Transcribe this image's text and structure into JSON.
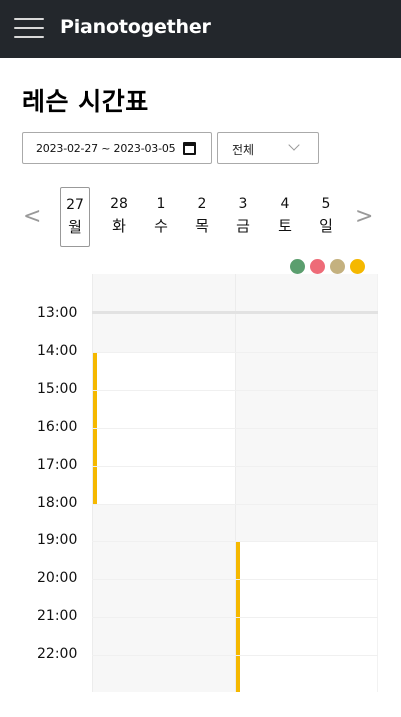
{
  "app": {
    "title": "Pianotogether"
  },
  "page": {
    "title": "레슨 시간표"
  },
  "date_range": {
    "value": "2023-02-27 ~ 2023-03-05"
  },
  "filter": {
    "selected": "전체"
  },
  "nav": {
    "prev_symbol": "<",
    "next_symbol": ">"
  },
  "days": [
    {
      "day": "27",
      "weekday": "월",
      "selected": true
    },
    {
      "day": "28",
      "weekday": "화",
      "selected": false
    },
    {
      "day": "1",
      "weekday": "수",
      "selected": false
    },
    {
      "day": "2",
      "weekday": "목",
      "selected": false
    },
    {
      "day": "3",
      "weekday": "금",
      "selected": false
    },
    {
      "day": "4",
      "weekday": "토",
      "selected": false
    },
    {
      "day": "5",
      "weekday": "일",
      "selected": false
    }
  ],
  "legend_colors": [
    "#5b9e6e",
    "#ee6b78",
    "#c4b17f",
    "#f5b800"
  ],
  "times": [
    "13:00",
    "14:00",
    "15:00",
    "16:00",
    "17:00",
    "18:00",
    "19:00",
    "20:00",
    "21:00",
    "22:00"
  ],
  "lessons": [
    {
      "column": 1,
      "start": "14:00",
      "end": "18:00",
      "color": "#f5b800"
    },
    {
      "column": 2,
      "start": "19:00",
      "end": "23:00",
      "color": "#f5b800"
    }
  ]
}
